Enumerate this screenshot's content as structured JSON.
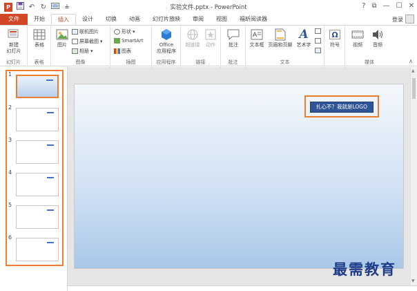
{
  "window": {
    "title": "实验文件.pptx - PowerPoint",
    "controls": [
      "?",
      "⧉",
      "—",
      "☐",
      "✕"
    ]
  },
  "qat": {
    "icons": [
      "save-icon",
      "undo-icon",
      "redo-icon",
      "start-from-beginning-icon",
      "customize-icon"
    ]
  },
  "tabs": [
    "文件",
    "开始",
    "插入",
    "设计",
    "切换",
    "动画",
    "幻灯片放映",
    "审阅",
    "视图",
    "福昕阅读器"
  ],
  "active_tab": "插入",
  "login": "登录",
  "ribbon": {
    "groups": {
      "slides": {
        "label": "幻灯片",
        "new_slide": "新建\n幻灯片"
      },
      "tables": {
        "label": "表格",
        "table": "表格"
      },
      "images": {
        "label": "图像",
        "picture": "图片",
        "online_pictures": "联机图片",
        "screenshot": "屏幕截图",
        "album": "相册"
      },
      "illustrations": {
        "label": "插图",
        "shapes": "形状",
        "smartart": "SmartArt",
        "chart": "图表"
      },
      "apps": {
        "label": "应用程序",
        "office_apps": "Office\n应用程序"
      },
      "links": {
        "label": "链接",
        "hyperlink": "超链接",
        "action": "动作"
      },
      "comments": {
        "label": "批注",
        "comment": "批注"
      },
      "text": {
        "label": "文本",
        "textbox": "文本框",
        "header_footer": "页眉和页脚",
        "wordart": "艺术字"
      },
      "symbols": {
        "label": "",
        "symbol": "符号"
      },
      "media": {
        "label": "媒体",
        "video": "视频",
        "audio": "音频"
      }
    }
  },
  "thumbnails": [
    {
      "number": "1",
      "selected": true
    },
    {
      "number": "2",
      "selected": false
    },
    {
      "number": "3",
      "selected": false
    },
    {
      "number": "4",
      "selected": false
    },
    {
      "number": "5",
      "selected": false
    },
    {
      "number": "6",
      "selected": false
    }
  ],
  "slide": {
    "logo_text": "扎心不？我就是LOGO"
  },
  "watermark": "最需教育",
  "colors": {
    "accent": "#d24726",
    "highlight": "#ed7d31",
    "logo_fill": "#2f5597"
  }
}
